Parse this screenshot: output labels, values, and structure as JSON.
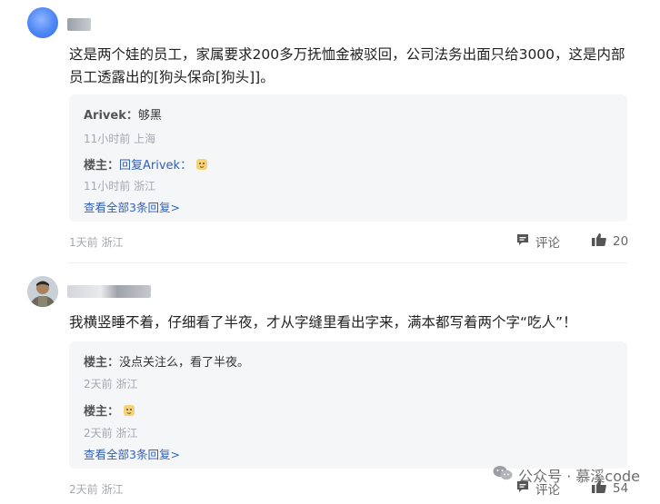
{
  "comments": [
    {
      "text": "这是两个娃的员工，家属要求200多万抚恤金被驳回，公司法务出面只给3000，这是内部员工透露出的[狗头保命[狗头]]。",
      "replies": [
        {
          "author": "Arivek：",
          "text": "够黑",
          "meta": "11小时前 上海"
        },
        {
          "author": "楼主：",
          "link": "回复Arivek：",
          "text": "",
          "meta": "11小时前 浙江"
        }
      ],
      "more": "查看全部3条回复>",
      "meta": "1天前 浙江",
      "comment_label": "评论",
      "likes": "20"
    },
    {
      "text": "我横竖睡不着，仔细看了半夜，才从字缝里看出字来，满本都写着两个字“吃人”！",
      "replies": [
        {
          "author": "楼主：",
          "text": "没点关注么，看了半夜。",
          "meta": "2天前 浙江"
        },
        {
          "author": "楼主：",
          "text": "",
          "meta": "2天前 浙江"
        }
      ],
      "more": "查看全部3条回复>",
      "meta": "2天前 浙江",
      "comment_label": "评论",
      "likes": "54"
    }
  ],
  "watermark": "公众号 · 慕溪code"
}
